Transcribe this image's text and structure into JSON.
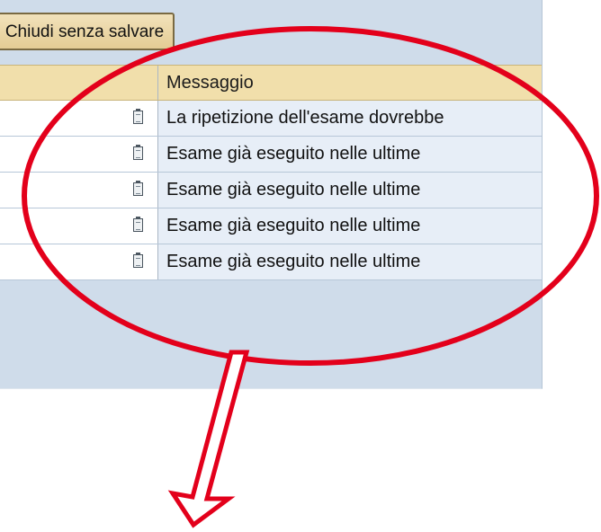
{
  "toolbar": {
    "close_without_save_label": "Chiudi senza salvare"
  },
  "table": {
    "columns": [
      "",
      "Messaggio"
    ],
    "rows": [
      {
        "messaggio": "La ripetizione dell'esame dovrebbe"
      },
      {
        "messaggio": "Esame già eseguito nelle ultime"
      },
      {
        "messaggio": "Esame già eseguito nelle ultime"
      },
      {
        "messaggio": "Esame già eseguito nelle ultime"
      },
      {
        "messaggio": "Esame già eseguito nelle ultime"
      }
    ]
  },
  "icons": {
    "row_icon": "document-icon"
  },
  "colors": {
    "panel_bg": "#cfdcea",
    "header_bg": "#f1dfab",
    "row_bg": "#e7eef7",
    "annotation": "#e3001b"
  }
}
